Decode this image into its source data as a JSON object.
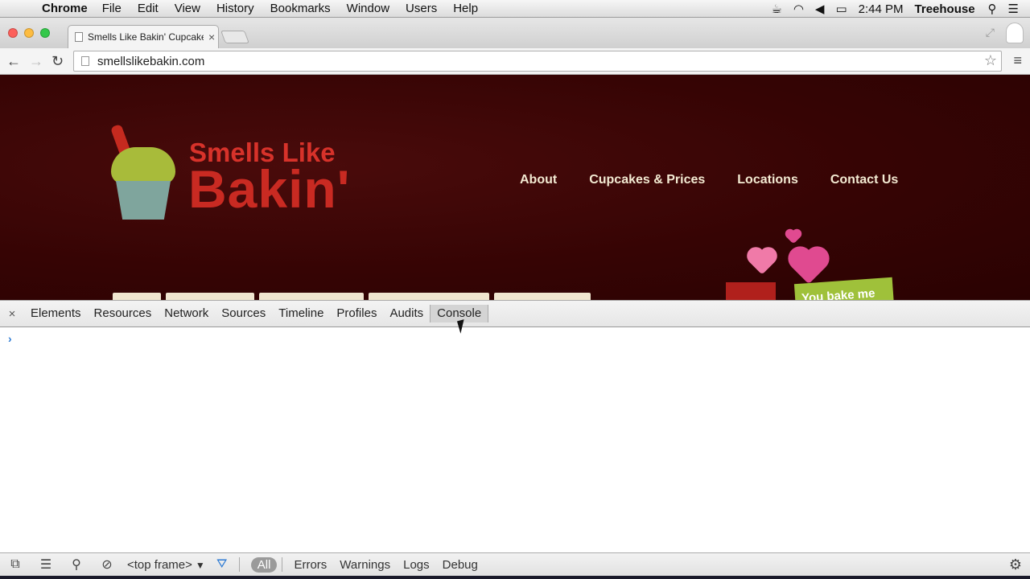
{
  "menubar": {
    "app": "Chrome",
    "items": [
      "File",
      "Edit",
      "View",
      "History",
      "Bookmarks",
      "Window",
      "Users",
      "Help"
    ],
    "clock": "2:44 PM",
    "user": "Treehouse"
  },
  "browser": {
    "tab_title": "Smells Like Bakin' Cupcake",
    "tab_close": "×",
    "url": "smellslikebakin.com"
  },
  "site": {
    "logo_line1": "Smells Like",
    "logo_line2": "Bakin'",
    "nav": [
      "About",
      "Cupcakes & Prices",
      "Locations",
      "Contact Us"
    ],
    "sign_text": "You bake me"
  },
  "devtools": {
    "close": "×",
    "tabs": [
      "Elements",
      "Resources",
      "Network",
      "Sources",
      "Timeline",
      "Profiles",
      "Audits",
      "Console"
    ],
    "active_tab": "Console",
    "prompt": "›"
  },
  "console_bar": {
    "frame": "<top frame>",
    "levels": [
      "All",
      "Errors",
      "Warnings",
      "Logs",
      "Debug"
    ],
    "active_level": "All"
  },
  "colors": {
    "site_background": "#360404",
    "logo_red": "#c92a22",
    "nav_text": "#f3ead2",
    "accent_blue": "#2e7bd4"
  },
  "icons": {
    "menubar": [
      "apple-icon",
      "coffee-icon",
      "wifi-icon",
      "volume-icon",
      "battery-icon",
      "spotlight-icon",
      "notification-list-icon"
    ],
    "console_bar": [
      "dock-icon",
      "drawer-icon",
      "search-icon",
      "clear-console-icon",
      "filter-icon",
      "gear-icon"
    ]
  }
}
